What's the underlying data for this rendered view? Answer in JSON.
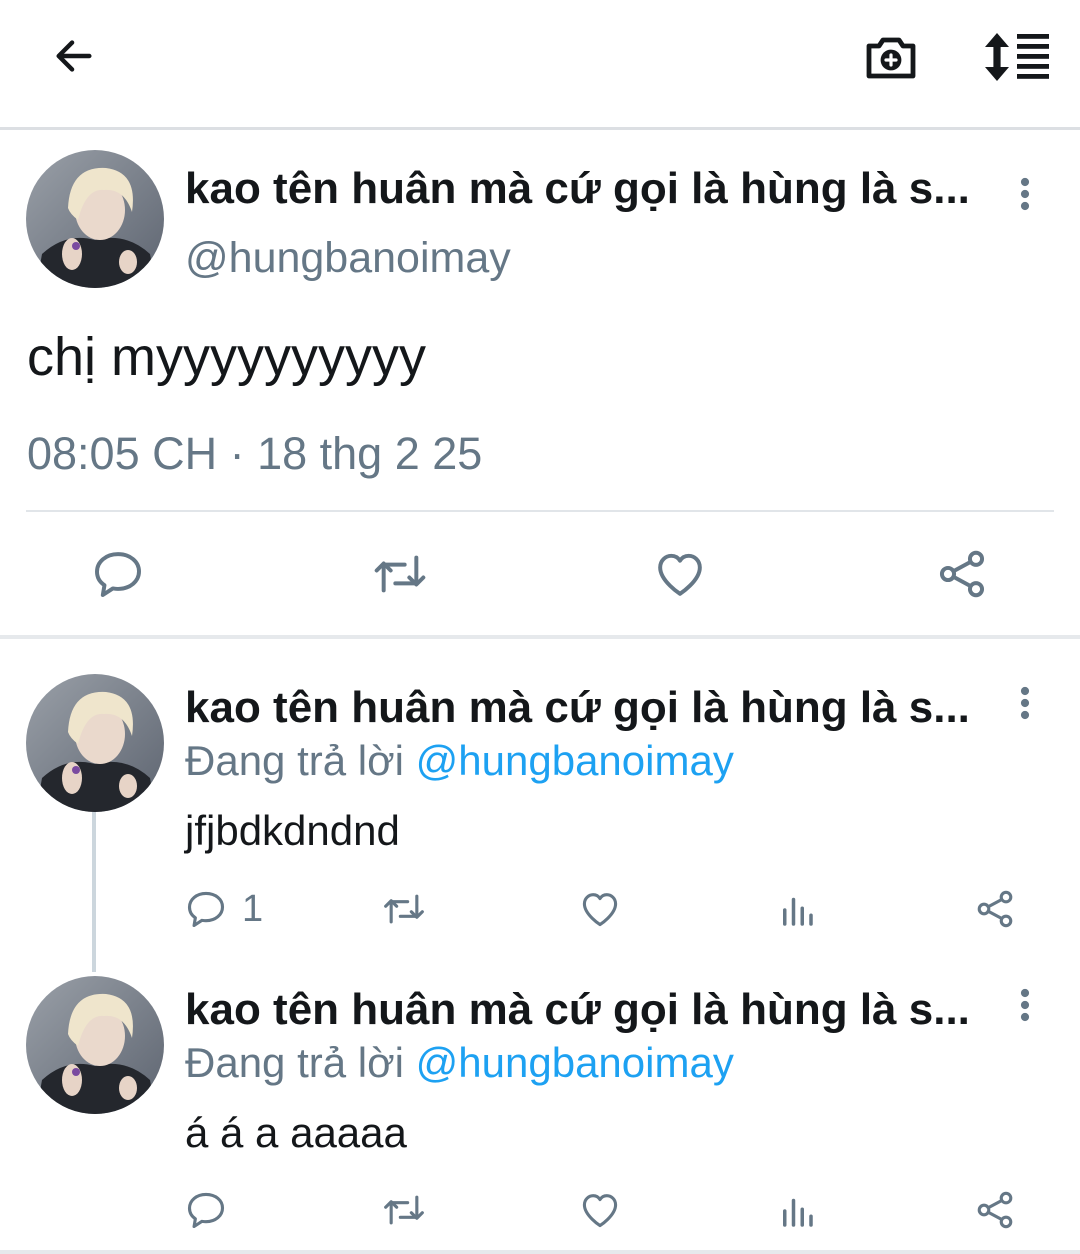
{
  "topbar": {
    "back_icon": "arrow-left-icon",
    "camera_icon": "camera-plus-icon",
    "sort_icon": "sort-list-icon"
  },
  "main_tweet": {
    "display_name": "kao tên huân mà cứ gọi là hùng là s...",
    "handle": "@hungbanoimay",
    "text": "chị myyyyyyyyyy",
    "timestamp": "08:05 CH · 18 thg 2 25",
    "actions": [
      "reply-icon",
      "retweet-icon",
      "like-icon",
      "share-icon"
    ]
  },
  "replies": [
    {
      "display_name": "kao tên huân mà cứ gọi là hùng là s...",
      "replying_label": "Đang trả lời ",
      "mention": "@hungbanoimay",
      "text": "jfjbdkdndnd",
      "reply_count": "1",
      "actions": [
        "reply-icon",
        "retweet-icon",
        "like-icon",
        "analytics-icon",
        "share-icon"
      ]
    },
    {
      "display_name": "kao tên huân mà cứ gọi là hùng là s...",
      "replying_label": "Đang trả lời ",
      "mention": "@hungbanoimay",
      "text": "á á a aaaaa",
      "reply_count": "",
      "actions": [
        "reply-icon",
        "retweet-icon",
        "like-icon",
        "analytics-icon",
        "share-icon"
      ]
    }
  ],
  "colors": {
    "text": "#14171a",
    "secondary": "#657786",
    "accent": "#1da1f2",
    "divider": "#e1e5e9"
  }
}
